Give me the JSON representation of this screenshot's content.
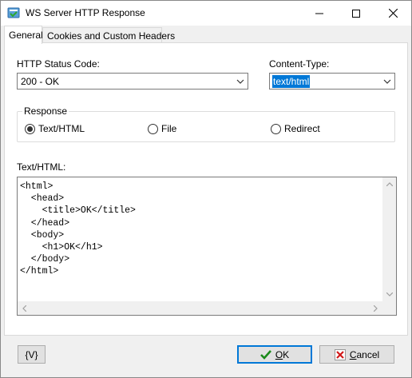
{
  "window": {
    "title": "WS Server HTTP Response"
  },
  "tabs": [
    {
      "label": "General",
      "active": true
    },
    {
      "label": "Cookies and Custom Headers",
      "active": false
    }
  ],
  "form": {
    "status_label": "HTTP Status Code:",
    "status_value": "200 - OK",
    "content_type_label": "Content-Type:",
    "content_type_value": "text/html"
  },
  "response": {
    "legend": "Response",
    "options": [
      {
        "label": "Text/HTML",
        "checked": true
      },
      {
        "label": "File",
        "checked": false
      },
      {
        "label": "Redirect",
        "checked": false
      }
    ]
  },
  "text_html": {
    "label": "Text/HTML:",
    "content": "<html>\n  <head>\n    <title>OK</title>\n  </head>\n  <body>\n    <h1>OK</h1>\n  </body>\n</html>"
  },
  "buttons": {
    "variables": "{V}",
    "ok_prefix": "",
    "ok_mnemonic": "O",
    "ok_rest": "K",
    "cancel_mnemonic": "C",
    "cancel_rest": "ancel"
  },
  "colors": {
    "accent": "#0078d7",
    "ok_check": "#1a8a1a",
    "cancel_x": "#d11a1a"
  }
}
